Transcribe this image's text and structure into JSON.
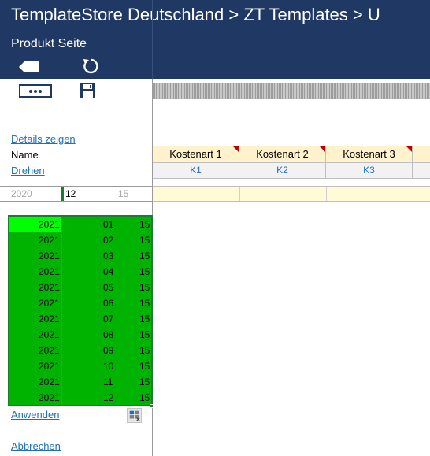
{
  "header": {
    "breadcrumb": "TemplateStore Deutschland > ZT  Templates > U",
    "subtitle": "Produkt Seite",
    "background_color": "#1f3864"
  },
  "toolbar": {
    "back_icon": "back-tag-icon",
    "refresh_icon": "refresh-icon",
    "more_icon": "more-options-icon",
    "save_icon": "save-icon"
  },
  "left_panel": {
    "details_link": "Details zeigen",
    "name_label": "Name",
    "rotate_link": "Drehen",
    "apply_link": "Anwenden",
    "cancel_link": "Abbrechen"
  },
  "columns": [
    {
      "header": "Kostenart 1",
      "code": "K1"
    },
    {
      "header": "Kostenart 2",
      "code": "K2"
    },
    {
      "header": "Kostenart 3",
      "code": "K3"
    },
    {
      "header": "",
      "code": ""
    }
  ],
  "period_row": {
    "year": "2020",
    "month": "12",
    "day": "15"
  },
  "selection": {
    "fill_color": "#00b300",
    "highlight_color": "#00ff00",
    "rows": [
      {
        "year": "2021",
        "month": "01",
        "day": "15"
      },
      {
        "year": "2021",
        "month": "02",
        "day": "15"
      },
      {
        "year": "2021",
        "month": "03",
        "day": "15"
      },
      {
        "year": "2021",
        "month": "04",
        "day": "15"
      },
      {
        "year": "2021",
        "month": "05",
        "day": "15"
      },
      {
        "year": "2021",
        "month": "06",
        "day": "15"
      },
      {
        "year": "2021",
        "month": "07",
        "day": "15"
      },
      {
        "year": "2021",
        "month": "08",
        "day": "15"
      },
      {
        "year": "2021",
        "month": "09",
        "day": "15"
      },
      {
        "year": "2021",
        "month": "10",
        "day": "15"
      },
      {
        "year": "2021",
        "month": "11",
        "day": "15"
      },
      {
        "year": "2021",
        "month": "12",
        "day": "15"
      }
    ]
  }
}
